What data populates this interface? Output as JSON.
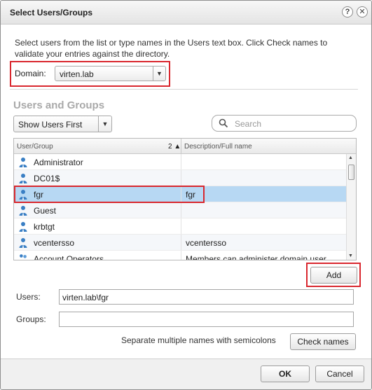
{
  "dialog": {
    "title": "Select Users/Groups",
    "help_glyph": "?",
    "close_glyph": "✕"
  },
  "instructions": "Select users from the list or type names in the Users text box. Click Check names to validate your entries against the directory.",
  "domain": {
    "label": "Domain:",
    "value": "virten.lab"
  },
  "section_title": "Users and Groups",
  "filter": {
    "value": "Show Users First"
  },
  "search": {
    "placeholder": "Search"
  },
  "grid": {
    "columns": [
      "User/Group",
      "Description/Full name"
    ],
    "sort_indicator": "2 ▲",
    "rows": [
      {
        "name": "Administrator",
        "description": "",
        "icon": "user-icon"
      },
      {
        "name": "DC01$",
        "description": "",
        "icon": "user-icon"
      },
      {
        "name": "fgr",
        "description": "fgr",
        "icon": "user-icon",
        "selected": true
      },
      {
        "name": "Guest",
        "description": "",
        "icon": "user-icon"
      },
      {
        "name": "krbtgt",
        "description": "",
        "icon": "user-icon"
      },
      {
        "name": "vcentersso",
        "description": "vcentersso",
        "icon": "user-icon"
      },
      {
        "name": "Account Operators",
        "description": "Members can administer domain user",
        "icon": "group-icon"
      }
    ]
  },
  "add_label": "Add",
  "users_field": {
    "label": "Users:",
    "value": "virten.lab\\fgr"
  },
  "groups_field": {
    "label": "Groups:",
    "value": ""
  },
  "hint": "Separate multiple names with semicolons",
  "check_names_label": "Check names",
  "ok_label": "OK",
  "cancel_label": "Cancel",
  "colors": {
    "highlight": "#d9272e",
    "selection": "#b7d8f3",
    "user_icon": "#3a7fc4"
  }
}
